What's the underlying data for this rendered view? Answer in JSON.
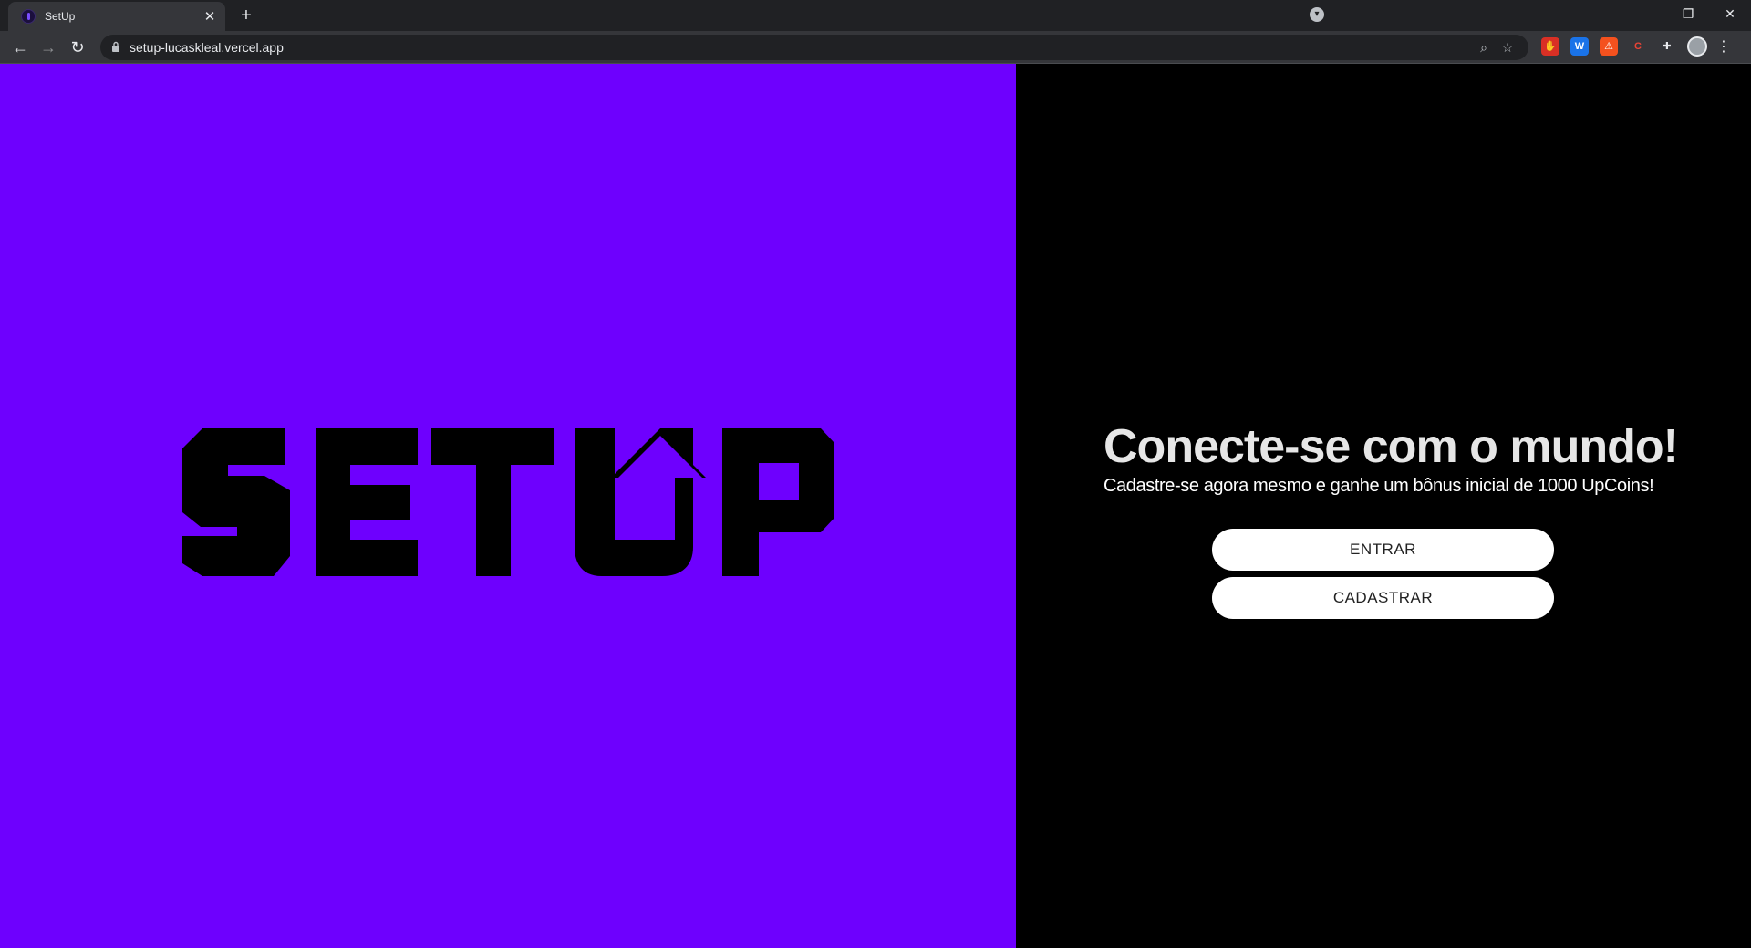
{
  "browser": {
    "tab_title": "SetUp",
    "tab_close": "✕",
    "new_tab": "+",
    "url": "setup-lucaskleal.vercel.app",
    "window_controls": {
      "minimize": "—",
      "restore": "❐",
      "close": "✕"
    },
    "nav": {
      "back": "←",
      "forward": "→",
      "reload": "↻"
    },
    "omnibox_icons": {
      "zoom": "⌕",
      "bookmark": "☆"
    },
    "lock": "🔒",
    "menu": "⋮",
    "profile_drop": "▾",
    "extensions": [
      {
        "name": "adblock-icon",
        "glyph": "✋",
        "color": "#d93025"
      },
      {
        "name": "translate-extension-icon",
        "glyph": "W",
        "color": "#1a73e8"
      },
      {
        "name": "orange-extension-icon",
        "glyph": "⚠",
        "color": "#f4511e"
      },
      {
        "name": "c-extension-icon",
        "glyph": "C",
        "color": "#ea4335"
      },
      {
        "name": "puzzle-icon",
        "glyph": "✚",
        "color": "#35363a"
      }
    ]
  },
  "colors": {
    "brand_purple": "#6e00fe",
    "panel_black": "#000000",
    "logo_fill": "#000000"
  },
  "logo": {
    "alt": "SETUP"
  },
  "hero": {
    "headline": "Conecte-se com o mundo!",
    "subline": "Cadastre-se agora mesmo e ganhe um bônus inicial de 1000 UpCoins!"
  },
  "actions": {
    "login_label": "ENTRAR",
    "signup_label": "CADASTRAR"
  }
}
